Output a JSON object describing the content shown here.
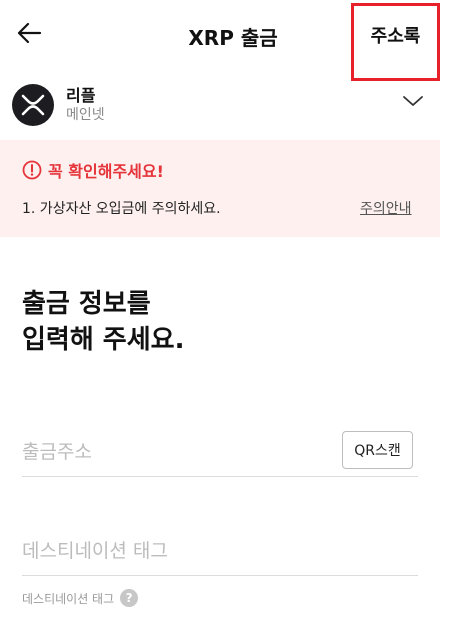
{
  "header": {
    "title": "XRP 출금",
    "address_book_label": "주소록",
    "highlight_color": "#e8202a"
  },
  "coin": {
    "name": "리플",
    "network": "메인넷",
    "icon": "xrp-logo-icon"
  },
  "warning": {
    "title": "꼭 확인해주세요!",
    "item": "1. 가상자산 오입금에 주의하세요.",
    "link": "주의안내",
    "accent_color": "#e5343a",
    "background_color": "#fdf0ef"
  },
  "form": {
    "heading_line1": "출금 정보를",
    "heading_line2": "입력해 주세요.",
    "address_placeholder": "출금주소",
    "address_value": "",
    "qr_button_label": "QR스캔",
    "tag_placeholder": "데스티네이션 태그",
    "tag_value": "",
    "tag_help_label": "데스티네이션 태그"
  }
}
